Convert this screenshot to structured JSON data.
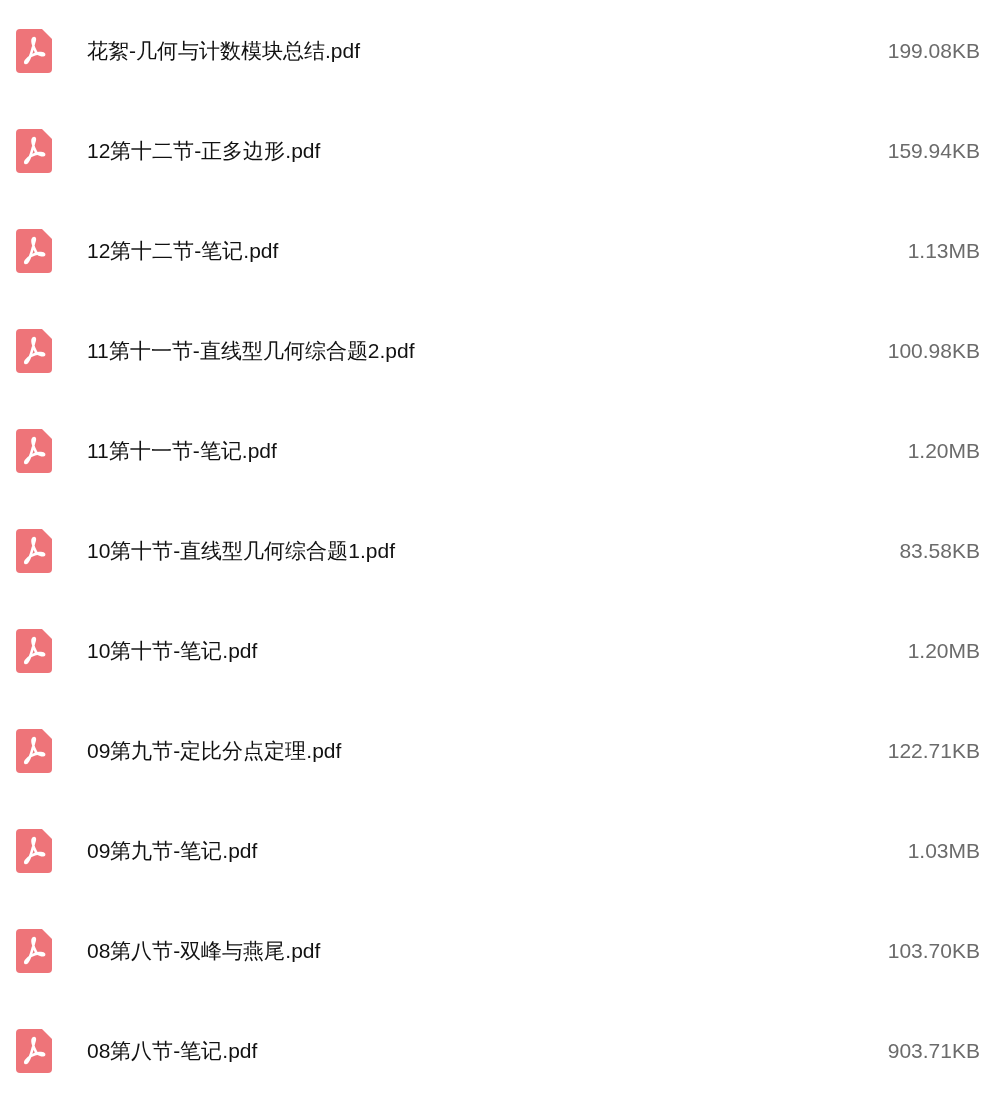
{
  "files": [
    {
      "name": "花絮-几何与计数模块总结.pdf",
      "size": "199.08KB"
    },
    {
      "name": "12第十二节-正多边形.pdf",
      "size": "159.94KB"
    },
    {
      "name": "12第十二节-笔记.pdf",
      "size": "1.13MB"
    },
    {
      "name": "11第十一节-直线型几何综合题2.pdf",
      "size": "100.98KB"
    },
    {
      "name": "11第十一节-笔记.pdf",
      "size": "1.20MB"
    },
    {
      "name": "10第十节-直线型几何综合题1.pdf",
      "size": "83.58KB"
    },
    {
      "name": "10第十节-笔记.pdf",
      "size": "1.20MB"
    },
    {
      "name": "09第九节-定比分点定理.pdf",
      "size": "122.71KB"
    },
    {
      "name": "09第九节-笔记.pdf",
      "size": "1.03MB"
    },
    {
      "name": "08第八节-双峰与燕尾.pdf",
      "size": "103.70KB"
    },
    {
      "name": "08第八节-笔记.pdf",
      "size": "903.71KB"
    }
  ]
}
